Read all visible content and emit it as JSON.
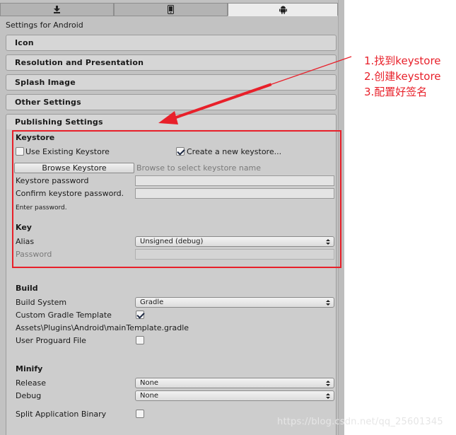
{
  "header": {
    "title": "Settings for Android"
  },
  "tabs": [
    {
      "icon": "download-icon"
    },
    {
      "icon": "phone-icon"
    },
    {
      "icon": "android-icon",
      "active": true
    }
  ],
  "sections": {
    "icon": "Icon",
    "resolution": "Resolution and Presentation",
    "splash": "Splash Image",
    "other": "Other Settings",
    "publishing": "Publishing Settings"
  },
  "keystore": {
    "heading": "Keystore",
    "use_existing_label": "Use Existing Keystore",
    "use_existing_checked": false,
    "create_new_label": "Create a new keystore...",
    "create_new_checked": true,
    "browse_button": "Browse Keystore",
    "browse_hint": "Browse to select keystore name",
    "password_label": "Keystore password",
    "confirm_label": "Confirm keystore password.",
    "enter_password_hint": "Enter password."
  },
  "key": {
    "heading": "Key",
    "alias_label": "Alias",
    "alias_value": "Unsigned (debug)",
    "password_label": "Password"
  },
  "build": {
    "heading": "Build",
    "system_label": "Build System",
    "system_value": "Gradle",
    "custom_gradle_label": "Custom Gradle Template",
    "custom_gradle_checked": true,
    "gradle_path": "Assets\\Plugins\\Android\\mainTemplate.gradle",
    "proguard_label": "User Proguard File",
    "proguard_checked": false
  },
  "minify": {
    "heading": "Minify",
    "release_label": "Release",
    "release_value": "None",
    "debug_label": "Debug",
    "debug_value": "None"
  },
  "split_binary": {
    "label": "Split Application Binary",
    "checked": false
  },
  "annotation": {
    "lines": [
      "1.找到keystore",
      "2.创建keystore",
      "3.配置好签名"
    ],
    "color": "#e8202a"
  },
  "watermark": "https://blog.csdn.net/qq_25601345"
}
